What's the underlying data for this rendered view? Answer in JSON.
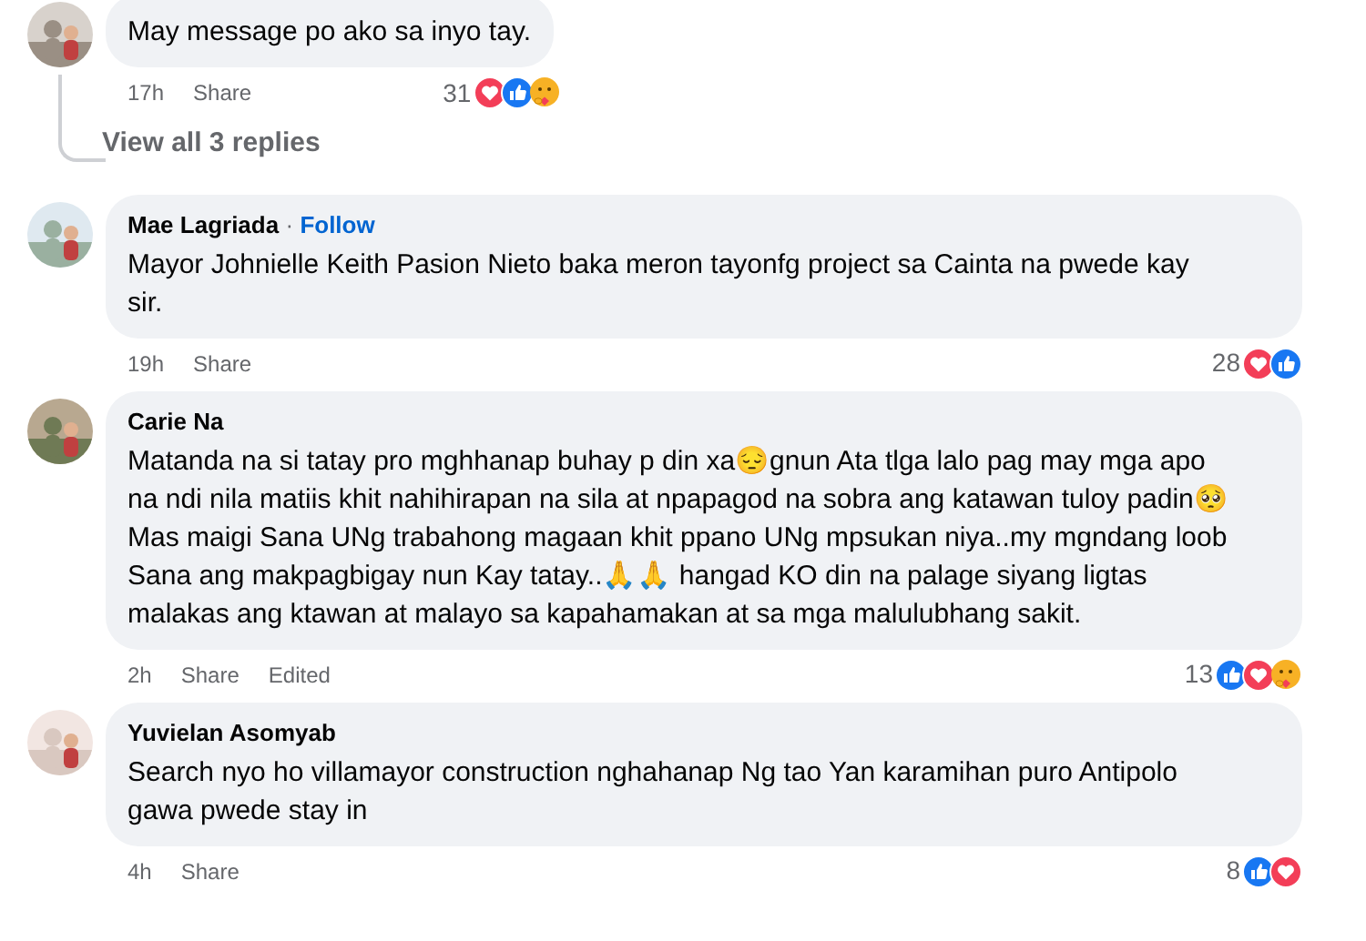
{
  "comments": [
    {
      "text": "May message po ako sa inyo tay.",
      "time": "17h",
      "actions": [
        "Share"
      ],
      "reaction_count": "31",
      "reactions": [
        {
          "kind": "love"
        },
        {
          "kind": "like"
        },
        {
          "kind": "care"
        }
      ],
      "replies_link": "View all 3 replies"
    },
    {
      "author": "Mae Lagriada",
      "separator": "·",
      "follow": "Follow",
      "text": "Mayor Johnielle Keith Pasion Nieto baka meron tayonfg project sa Cainta na pwede kay sir.",
      "time": "19h",
      "actions": [
        "Share"
      ],
      "reaction_count": "28",
      "reactions": [
        {
          "kind": "love"
        },
        {
          "kind": "like"
        }
      ]
    },
    {
      "author": "Carie Na",
      "text": "Matanda na si tatay pro mghhanap buhay p din xa😔gnun Ata tlga lalo pag may mga apo na ndi nila matiis khit nahihirapan na sila at npapagod na sobra ang katawan tuloy padin🥺 Mas maigi Sana UNg trabahong magaan khit ppano UNg mpsukan niya..my mgndang loob Sana ang makpagbigay nun Kay tatay..🙏🙏 hangad KO din na palage siyang ligtas malakas ang ktawan at malayo sa kapahamakan at sa mga malulubhang sakit.",
      "time": "2h",
      "actions": [
        "Share",
        "Edited"
      ],
      "reaction_count": "13",
      "reactions": [
        {
          "kind": "like"
        },
        {
          "kind": "love"
        },
        {
          "kind": "care"
        }
      ]
    },
    {
      "author": "Yuvielan Asomyab",
      "text": "Search nyo ho villamayor construction nghahanap Ng tao Yan karamihan puro Antipolo gawa pwede stay in",
      "time": "4h",
      "actions": [
        "Share"
      ],
      "reaction_count": "8",
      "reactions": [
        {
          "kind": "like"
        },
        {
          "kind": "love"
        }
      ]
    }
  ]
}
